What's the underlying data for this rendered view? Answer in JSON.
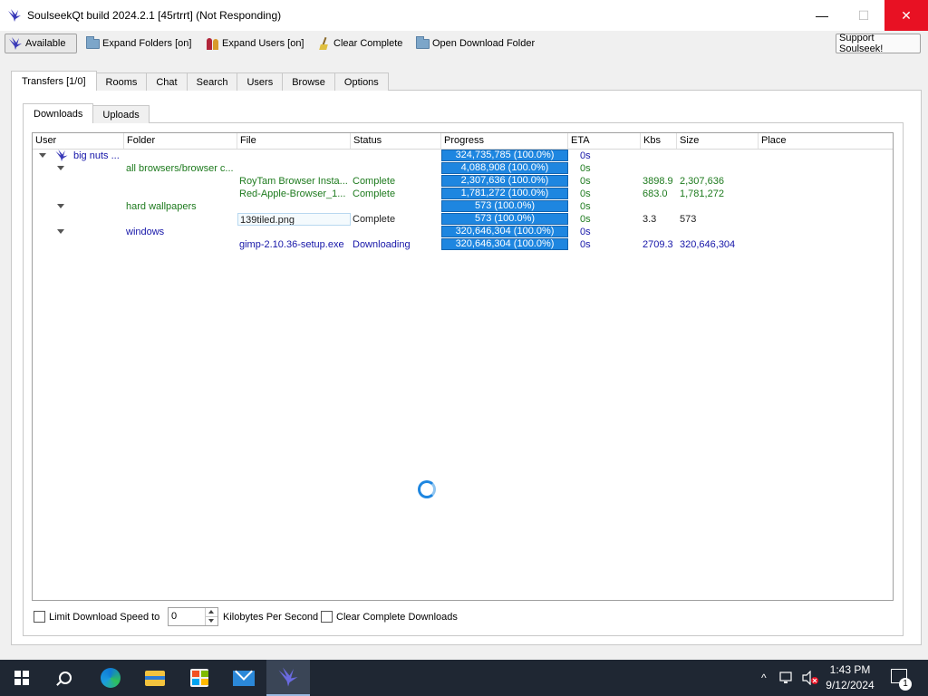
{
  "window": {
    "title": "SoulseekQt build 2024.2.1 [45rtrrt] (Not Responding)",
    "min_glyph": "—",
    "max_glyph": "☐",
    "close_glyph": "✕",
    "app_icon": "soulseek-bird-icon"
  },
  "toolbar": {
    "available": "Available",
    "expand_folders": "Expand Folders [on]",
    "expand_users": "Expand Users [on]",
    "clear_complete": "Clear Complete",
    "open_download_folder": "Open Download Folder",
    "support": "Support Soulseek!"
  },
  "tabs": [
    "Transfers [1/0]",
    "Rooms",
    "Chat",
    "Search",
    "Users",
    "Browse",
    "Options"
  ],
  "subtabs": [
    "Downloads",
    "Uploads"
  ],
  "columns": [
    "User",
    "Folder",
    "File",
    "Status",
    "Progress",
    "ETA",
    "Kbs",
    "Size",
    "Place"
  ],
  "rows": [
    {
      "user": "big nuts ...",
      "folder": "",
      "file": "",
      "status": "",
      "progress": "324,735,785 (100.0%)",
      "eta": "0s",
      "kbs": "",
      "size": "",
      "place": ""
    },
    {
      "user": "",
      "folder": "all browsers/browser c...",
      "file": "",
      "status": "",
      "progress": "4,088,908 (100.0%)",
      "eta": "0s",
      "kbs": "",
      "size": "",
      "place": ""
    },
    {
      "user": "",
      "folder": "",
      "file": "RoyTam Browser Insta...",
      "status": "Complete",
      "progress": "2,307,636 (100.0%)",
      "eta": "0s",
      "kbs": "3898.9",
      "size": "2,307,636",
      "place": ""
    },
    {
      "user": "",
      "folder": "",
      "file": "Red-Apple-Browser_1...",
      "status": "Complete",
      "progress": "1,781,272 (100.0%)",
      "eta": "0s",
      "kbs": "683.0",
      "size": "1,781,272",
      "place": ""
    },
    {
      "user": "",
      "folder": "hard wallpapers",
      "file": "",
      "status": "",
      "progress": "573 (100.0%)",
      "eta": "0s",
      "kbs": "",
      "size": "",
      "place": ""
    },
    {
      "user": "",
      "folder": "",
      "file": "139tiled.png",
      "status": "Complete",
      "progress": "573 (100.0%)",
      "eta": "0s",
      "kbs": "3.3",
      "size": "573",
      "place": ""
    },
    {
      "user": "",
      "folder": "windows",
      "file": "",
      "status": "",
      "progress": "320,646,304 (100.0%)",
      "eta": "0s",
      "kbs": "",
      "size": "",
      "place": ""
    },
    {
      "user": "",
      "folder": "",
      "file": "gimp-2.10.36-setup.exe",
      "status": "Downloading",
      "progress": "320,646,304 (100.0%)",
      "eta": "0s",
      "kbs": "2709.3",
      "size": "320,646,304",
      "place": ""
    }
  ],
  "bottom": {
    "limit_label": "Limit Download Speed to",
    "speed_value": "0",
    "units": "Kilobytes Per Second",
    "clear_complete_label": "Clear Complete Downloads"
  },
  "taskbar": {
    "time": "1:43 PM",
    "date": "9/12/2024",
    "notifications": "1",
    "chevron": "^"
  }
}
